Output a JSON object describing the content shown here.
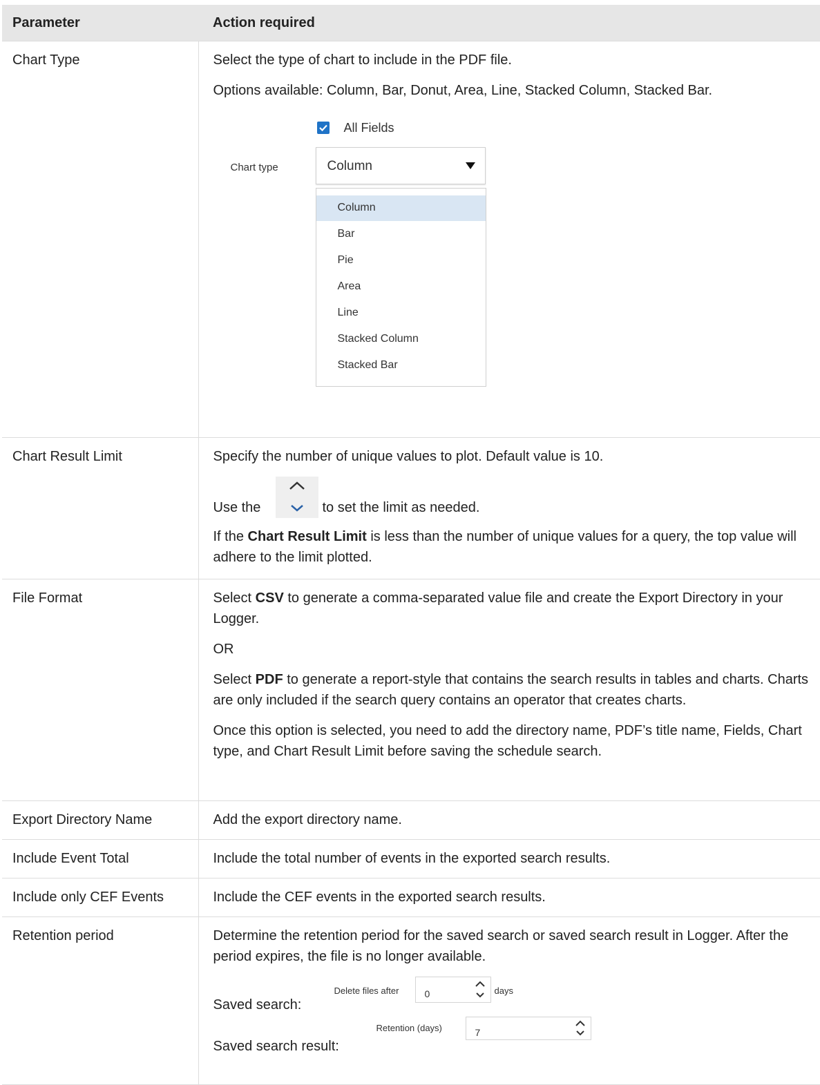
{
  "table": {
    "headers": [
      "Parameter",
      "Action required"
    ],
    "chart_type": {
      "param": "Chart Type",
      "line1": "Select the type of chart to include in the PDF file.",
      "line2": "Options available: Column, Bar, Donut, Area, Line, Stacked Column, Stacked Bar.",
      "figure": {
        "checkbox_label": "All Fields",
        "checkbox_checked": true,
        "select_label": "Chart type",
        "selected_value": "Column",
        "options": [
          "Column",
          "Bar",
          "Pie",
          "Area",
          "Line",
          "Stacked Column",
          "Stacked Bar"
        ]
      }
    },
    "chart_result_limit": {
      "param": "Chart Result Limit",
      "line1": "Specify the number of unique values to plot. Default value is 10.",
      "use_pre": "Use the",
      "use_post": "to set the limit as needed.",
      "if_pre": "If the ",
      "if_bold": "Chart Result Limit",
      "if_post": " is less than the number of unique values for a query, the top value will adhere to the limit plotted."
    },
    "file_format": {
      "param": "File Format",
      "csv_pre": "Select ",
      "csv_bold": "CSV",
      "csv_post": " to generate a comma-separated value file and create the Export Directory in your Logger.",
      "or": "OR",
      "pdf_pre": "Select ",
      "pdf_bold": "PDF",
      "pdf_post": " to generate a report-style that contains the search results in tables and charts. Charts are only included if the search query contains an operator that creates charts.",
      "once": "Once this option is selected, you need to add the directory name, PDF’s title name, Fields, Chart type, and Chart Result Limit before saving the schedule search."
    },
    "export_directory": {
      "param": "Export Directory Name",
      "action": "Add the export directory name."
    },
    "include_event_total": {
      "param": "Include Event Total",
      "action": "Include the total number of events in the exported search results."
    },
    "include_cef": {
      "param": "Include only CEF Events",
      "action": "Include the CEF events in the exported search results."
    },
    "retention": {
      "param": "Retention period",
      "line1": "Determine the retention period for the saved search or saved search result in Logger. After the period expires, the file is no longer available.",
      "saved_search_label": "Saved search:",
      "delete_files_label": "Delete files after",
      "delete_files_value": "0",
      "days_label": "days",
      "saved_result_label": "Saved search result:",
      "retention_days_label": "Retention (days)",
      "retention_days_value": "7"
    }
  }
}
